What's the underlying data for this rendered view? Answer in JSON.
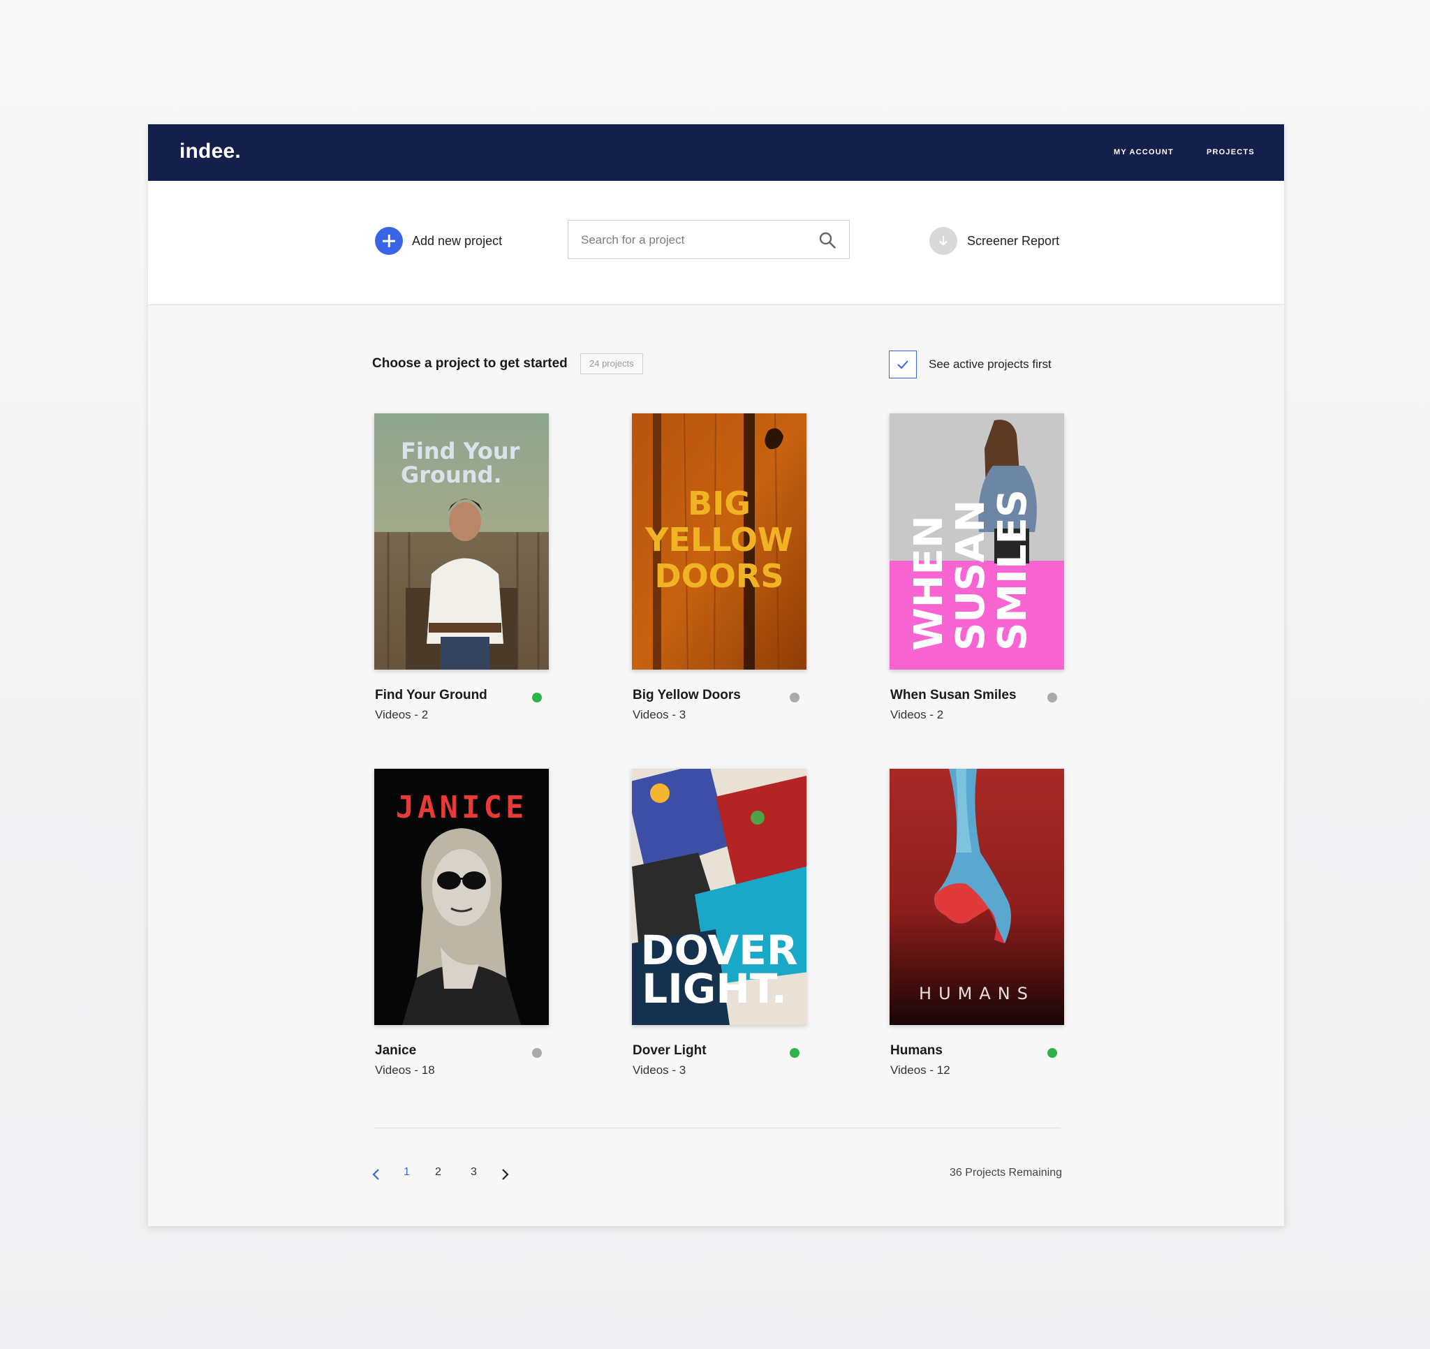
{
  "header": {
    "logo": "indee.",
    "nav": [
      "MY ACCOUNT",
      "PROJECTS"
    ]
  },
  "toolbar": {
    "add_label": "Add new project",
    "search_placeholder": "Search for a project",
    "screener_label": "Screener Report"
  },
  "content": {
    "heading": "Choose a project to get started",
    "count_badge": "24 projects",
    "active_first_label": "See active projects first",
    "active_first_checked": true
  },
  "projects": [
    {
      "title": "Find Your Ground",
      "videos": "Videos - 2",
      "active": true,
      "poster_text": [
        "Find Your",
        "Ground."
      ]
    },
    {
      "title": "Big Yellow Doors",
      "videos": "Videos - 3",
      "active": false,
      "poster_text": [
        "BIG",
        "YELLOW",
        "DOORS"
      ]
    },
    {
      "title": "When Susan Smiles",
      "videos": "Videos - 2",
      "active": false,
      "poster_text": [
        "WHEN",
        "SUSAN",
        "SMILES"
      ]
    },
    {
      "title": "Janice",
      "videos": "Videos - 18",
      "active": false,
      "poster_text": [
        "JANICE"
      ]
    },
    {
      "title": "Dover Light",
      "videos": "Videos - 3",
      "active": true,
      "poster_text": [
        "DOVER",
        "LIGHT."
      ]
    },
    {
      "title": "Humans",
      "videos": "Videos - 12",
      "active": true,
      "poster_text": [
        "HUMANS"
      ]
    }
  ],
  "pagination": {
    "pages": [
      "1",
      "2",
      "3"
    ],
    "current": "1",
    "remaining": "36 Projects Remaining"
  },
  "colors": {
    "header_bg": "#141f4c",
    "accent": "#3a64e6",
    "active_dot": "#2db34a",
    "inactive_dot": "#aaaaaa"
  },
  "icons": {
    "add": "plus-icon",
    "search": "search-icon",
    "screener": "download-icon",
    "checkbox": "check-icon",
    "prev": "chevron-left-icon",
    "next": "chevron-right-icon"
  }
}
